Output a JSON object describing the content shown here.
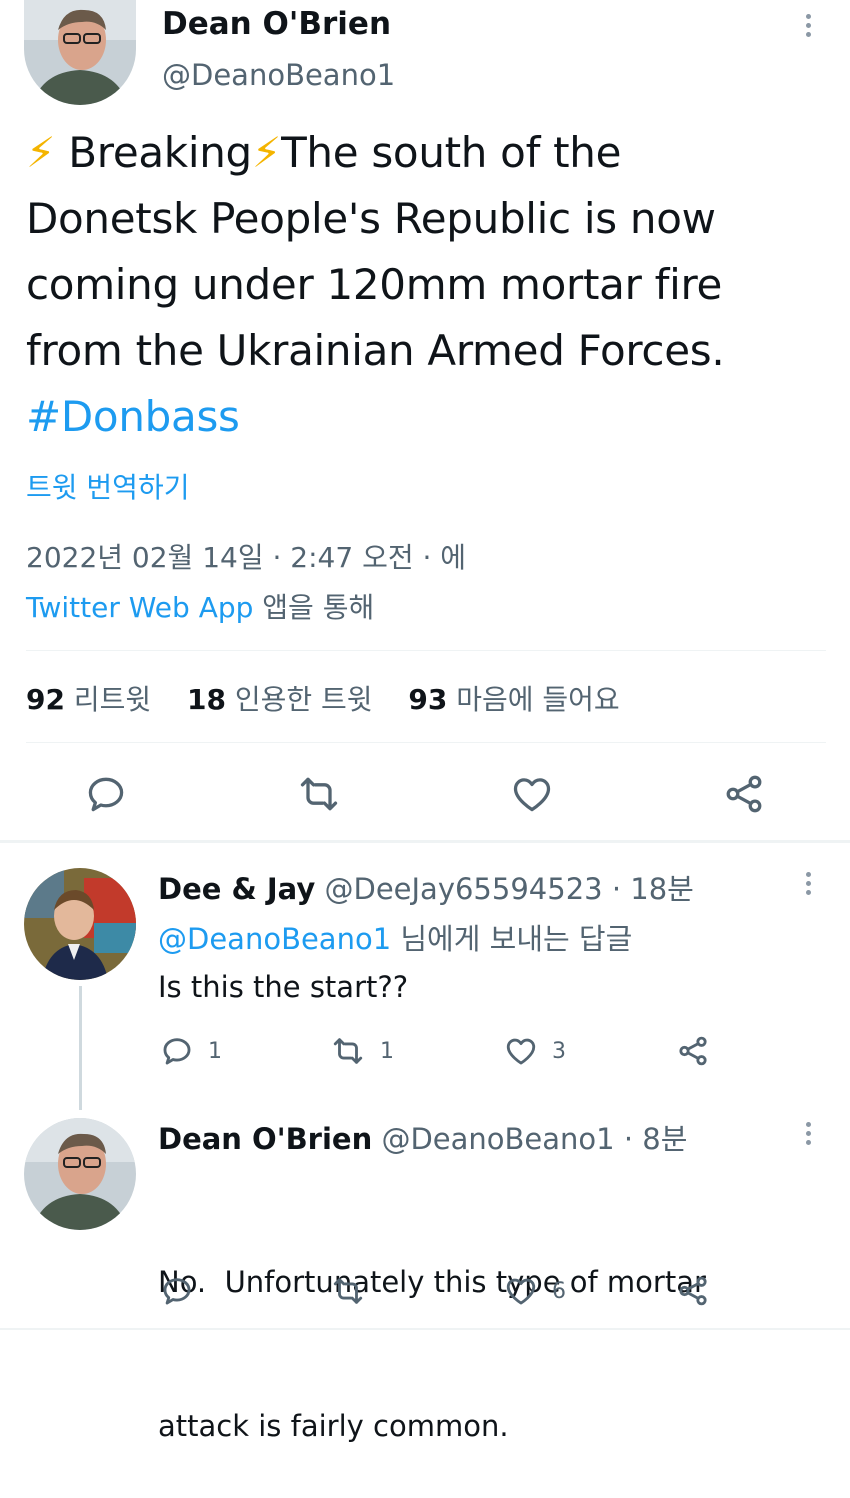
{
  "main_tweet": {
    "author_name": "Dean O'Brien",
    "author_handle": "@DeanoBeano1",
    "text_prefix_emoji": "⚡",
    "text_breaking": "Breaking",
    "text_mid_emoji": "⚡",
    "text_line1": "The south of the",
    "text_line2": "Donetsk People's Republic is now",
    "text_line3": "coming under 120mm mortar fire",
    "text_line4": "from the Ukrainian Armed Forces.",
    "hashtag": "#Donbass",
    "translate_label": "트윗 번역하기",
    "timestamp": "2022년 02월 14일 · 2:47 오전 · 에",
    "source_app": "Twitter Web App",
    "source_suffix": "앱을 통해",
    "stats": {
      "retweets_count": "92",
      "retweets_label": "리트윗",
      "quotes_count": "18",
      "quotes_label": "인용한 트윗",
      "likes_count": "93",
      "likes_label": "마음에 들어요"
    }
  },
  "replies": [
    {
      "author_name": "Dee & Jay",
      "author_handle": "@DeeJay65594523",
      "time": "· 18분",
      "reply_to_handle": "@DeanoBeano1",
      "reply_to_suffix": "님에게 보내는 답글",
      "text": "Is this the start??",
      "reply_count": "1",
      "retweet_count": "1",
      "like_count": "3"
    },
    {
      "author_name": "Dean O'Brien",
      "author_handle": "@DeanoBeano1",
      "time": "· 8분",
      "text_line1": "No.  Unfortunately this type of mortar",
      "text_line2": "attack is fairly common.",
      "like_count": "6"
    }
  ],
  "colors": {
    "accent_blue": "#1d9bf0",
    "text": "#0f1419",
    "secondary": "#536471",
    "divider": "#eff3f4",
    "lightning": "#f4b400"
  },
  "icons": [
    "more-icon",
    "reply-icon",
    "retweet-icon",
    "like-icon",
    "share-icon"
  ]
}
